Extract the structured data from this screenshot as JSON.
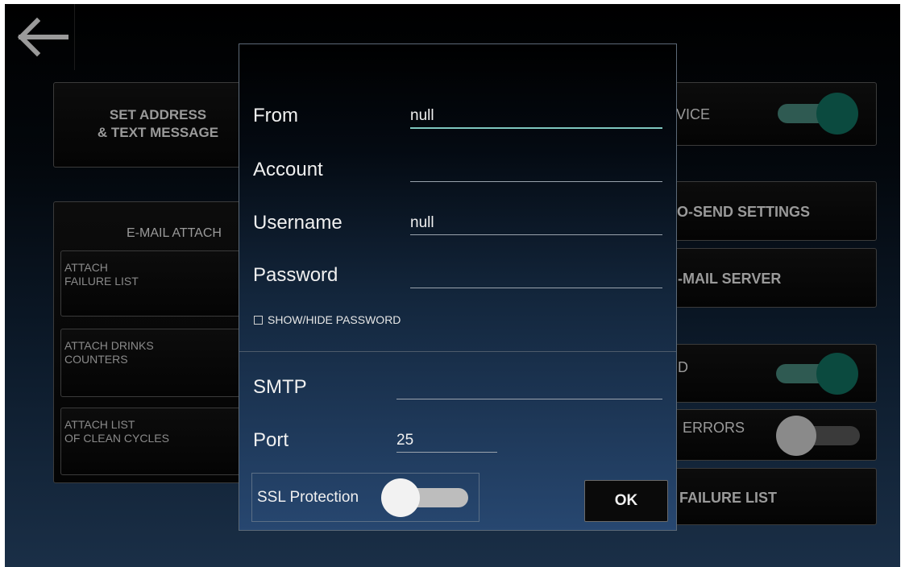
{
  "background": {
    "set_address_tile": "SET ADDRESS\n& TEXT MESSAGE",
    "attach_group_title": "E-MAIL ATTACH",
    "attach_failure": "ATTACH\nFAILURE LIST",
    "attach_drinks": "ATTACH DRINKS\nCOUNTERS",
    "attach_clean": "ATTACH LIST\nOF CLEAN CYCLES",
    "service_label": "VICE",
    "auto_send": "O-SEND SETTINGS",
    "mail_server": "-MAIL SERVER",
    "row4_label": "D",
    "errors_label": "ERRORS",
    "failure_list": "FAILURE LIST"
  },
  "dialog": {
    "from_label": "From",
    "from_value": "null",
    "account_label": "Account",
    "account_value": "",
    "username_label": "Username",
    "username_value": "null",
    "password_label": "Password",
    "password_value": "",
    "show_hide_label": "SHOW/HIDE PASSWORD",
    "smtp_label": "SMTP",
    "smtp_value": "",
    "port_label": "Port",
    "port_value": "25",
    "ssl_label": "SSL Protection",
    "ok_label": "OK"
  },
  "colors": {
    "switch_on_track": "#2f5a52",
    "switch_on_thumb": "#0b4a3f",
    "switch_off_track": "#3a3a3a",
    "switch_off_thumb": "#8a8a8a",
    "ssl_off_track": "#bdbdbd",
    "ssl_off_thumb": "#f2f2f2",
    "accent_underline": "#7fc7c0"
  },
  "switches": {
    "service": "on",
    "row4": "on",
    "errors": "off",
    "ssl_protection": "off"
  }
}
